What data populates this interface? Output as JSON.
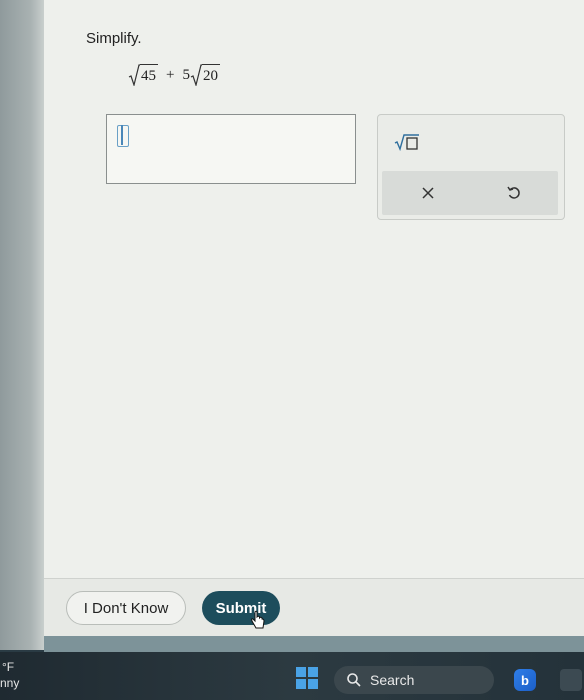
{
  "question": {
    "prompt": "Simplify.",
    "expression": {
      "term1_radicand": "45",
      "operator": "+",
      "term2_coefficient": "5",
      "term2_radicand": "20"
    }
  },
  "answer_input": {
    "value": ""
  },
  "palette": {
    "sqrt_label": "√□",
    "clear_label": "×",
    "undo_label": "↺"
  },
  "footer": {
    "dont_know_label": "I Don't Know",
    "submit_label": "Submit"
  },
  "taskbar": {
    "weather_temp": "°F",
    "weather_text": "nny",
    "search_label": "Search",
    "bing_label": "b"
  },
  "colors": {
    "submit_bg": "#1d4d5c",
    "start_blue": "#4aa3e6"
  }
}
